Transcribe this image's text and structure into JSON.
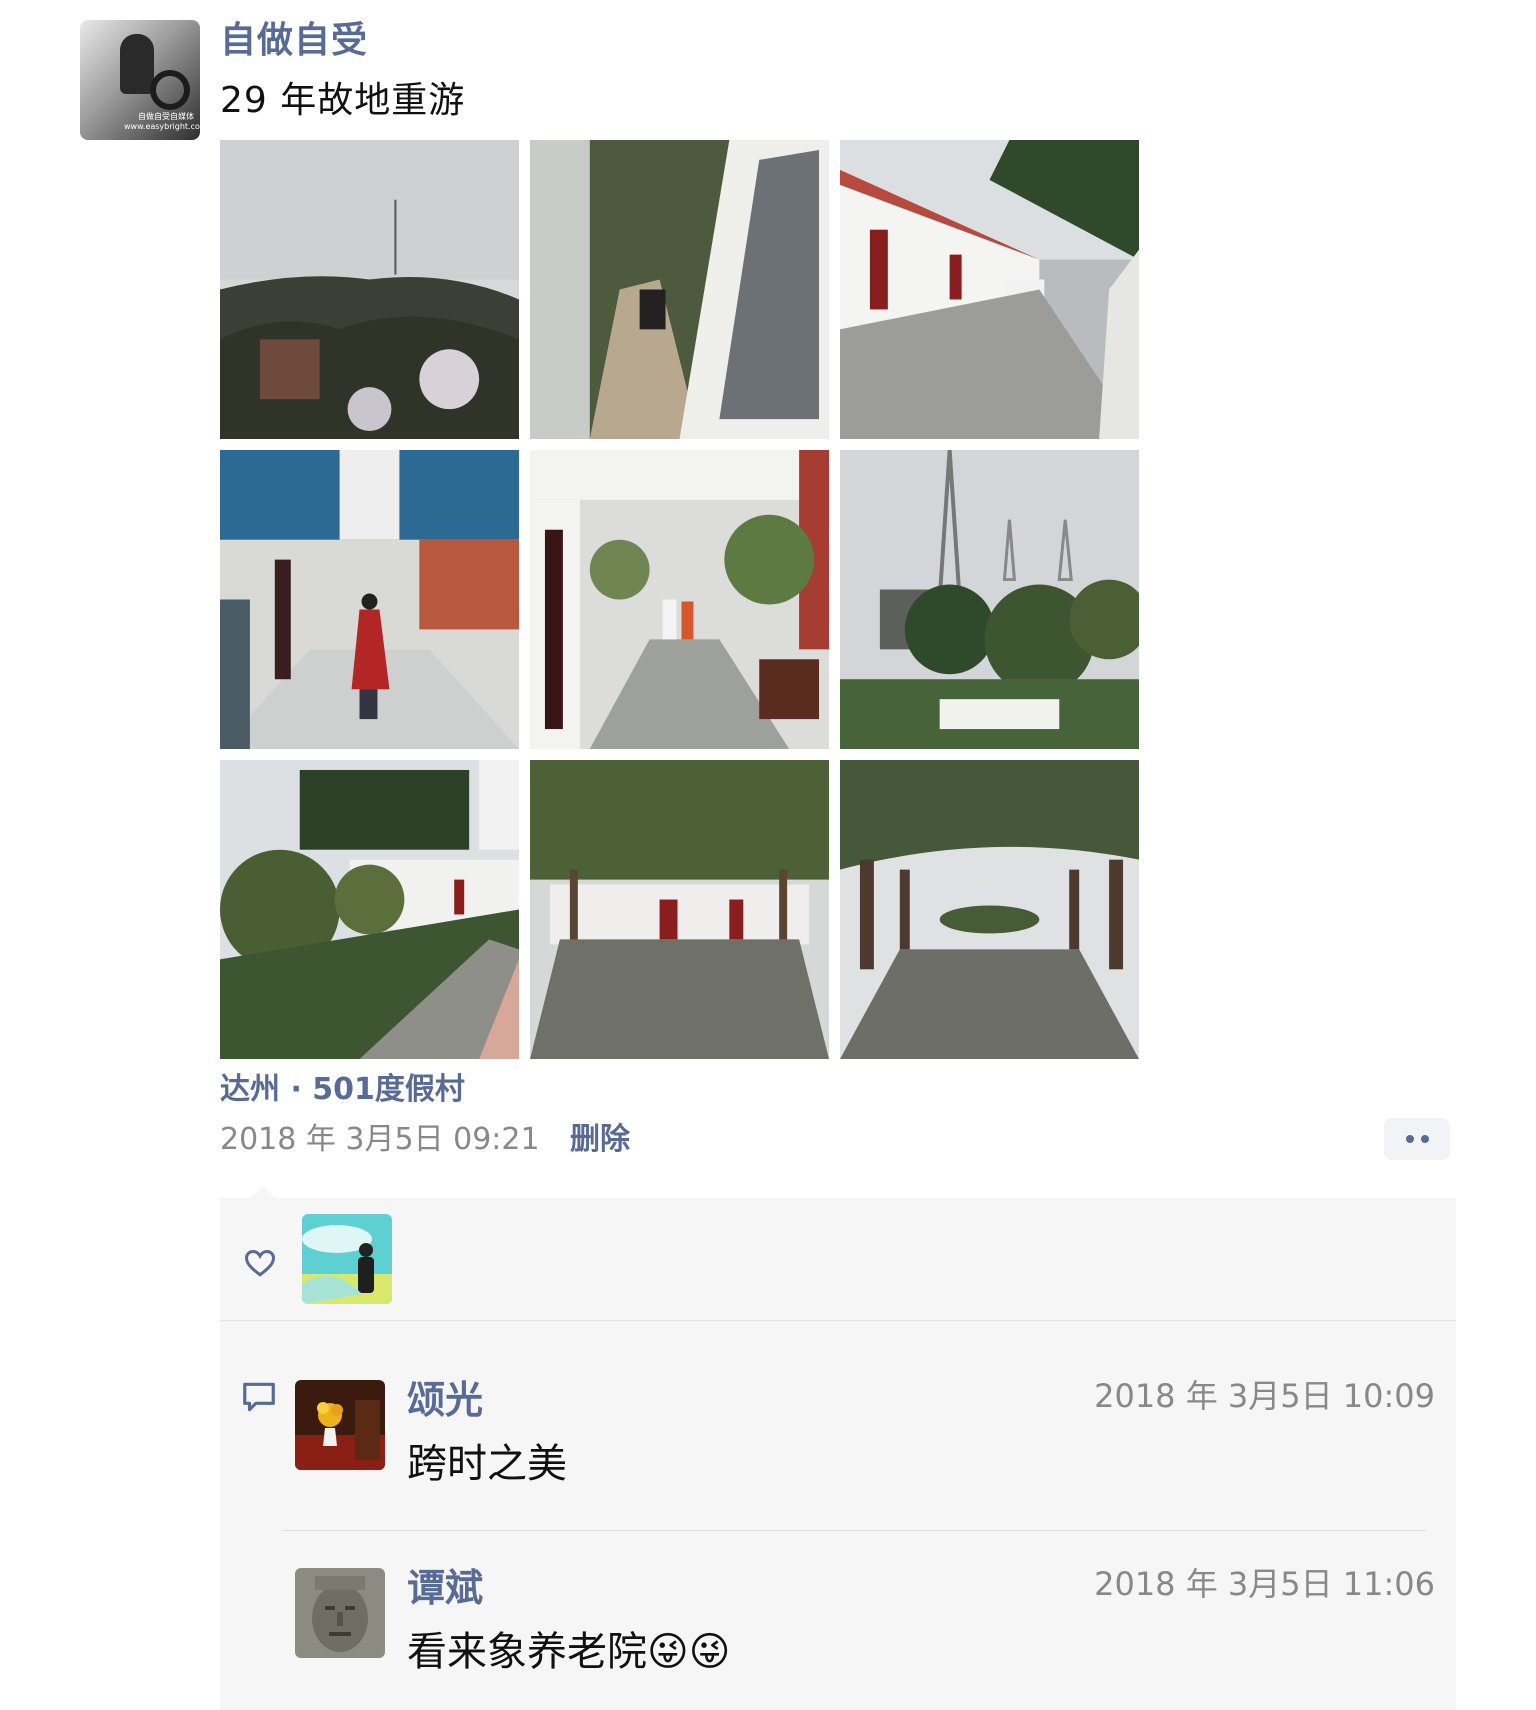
{
  "post": {
    "author": "自做自受",
    "author_avatar_icon": "person-at-lathe-avatar",
    "text": "29 年故地重游",
    "photos": [
      {
        "name": "photo-hill-tower",
        "icon": "hill-with-tower-photo"
      },
      {
        "name": "photo-van-path",
        "icon": "van-beside-wall-photo"
      },
      {
        "name": "photo-building-car",
        "icon": "building-with-car-photo"
      },
      {
        "name": "photo-corridor-person",
        "icon": "corridor-with-person-photo"
      },
      {
        "name": "photo-courtyard-walkers",
        "icon": "courtyard-walkers-photo"
      },
      {
        "name": "photo-towers-trees",
        "icon": "radio-towers-trees-photo"
      },
      {
        "name": "photo-garden-path",
        "icon": "garden-path-photo"
      },
      {
        "name": "photo-trellis-courtyard",
        "icon": "trellis-courtyard-photo"
      },
      {
        "name": "photo-pergola-walkway",
        "icon": "pergola-walkway-photo"
      }
    ],
    "location": "达州 · 501度假村",
    "timestamp": "2018 年 3月5日 09:21",
    "delete_label": "删除",
    "more_icon": "more-dots-icon"
  },
  "likes": {
    "icon": "heart-icon",
    "avatars": [
      "liker-avatar"
    ]
  },
  "comments": [
    {
      "name": "颂光",
      "time": "2018 年 3月5日 10:09",
      "text": "跨时之美",
      "avatar_icon": "flower-vase-avatar"
    },
    {
      "name": "谭斌",
      "time": "2018 年 3月5日 11:06",
      "text": "看来象养老院😜😜",
      "avatar_icon": "stone-face-avatar"
    }
  ],
  "colors": {
    "link": "#576b95",
    "panel_bg": "#f6f6f6",
    "meta_text": "#888888"
  }
}
